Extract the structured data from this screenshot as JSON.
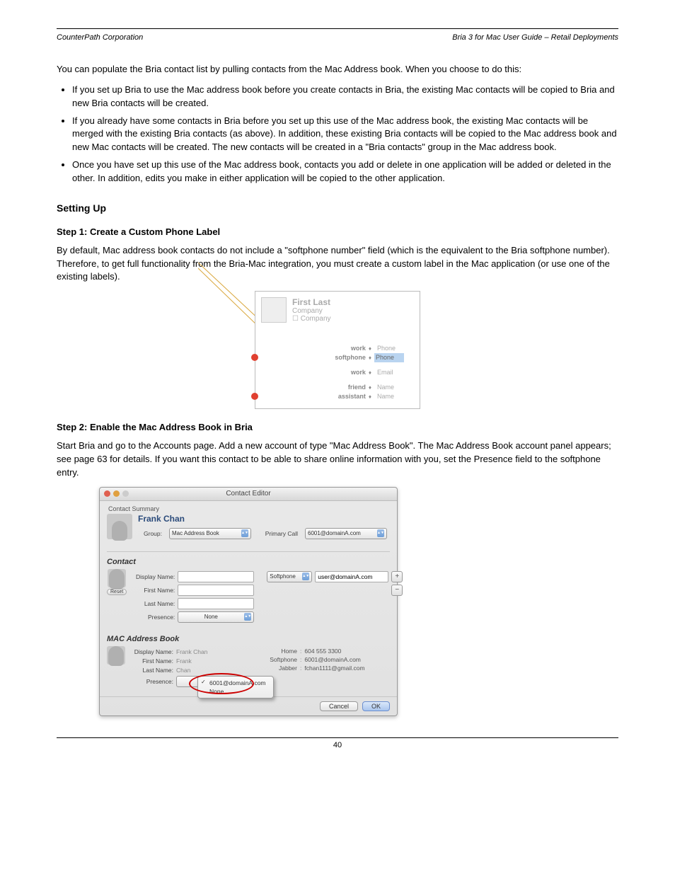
{
  "header": {
    "left": "CounterPath Corporation",
    "right": "Bria 3 for Mac User Guide – Retail Deployments"
  },
  "intro": "You can populate the Bria contact list by pulling contacts from the Mac Address book. When you choose to do this:",
  "bullets": [
    "If you set up Bria to use the Mac address book before you create contacts in Bria, the existing Mac contacts will be copied to Bria and new Bria contacts will be created.",
    "If you already have some contacts in Bria before you set up this use of the Mac address book, the existing Mac contacts will be merged with the existing Bria contacts (as above). In addition, these existing Bria contacts will be copied to the Mac address book and new Mac contacts will be created. The new contacts will be created in a \"Bria contacts\" group in the Mac address book.",
    "Once you have set up this use of the Mac address book, contacts you add or delete in one application will be added or deleted in the other. In addition, edits you make in either application will be copied to the other application."
  ],
  "setupTitle": "Setting Up",
  "step1Title": "Step 1: Create a Custom Phone Label",
  "step1Text": "By default, Mac address book contacts do not include a \"softphone number\" field (which is the equivalent to the Bria softphone number). Therefore, to get full functionality from the Bria-Mac integration, you must create a custom label in the Mac application (or use one of the existing labels).",
  "addressCard": {
    "name": "First Last",
    "company": "Company",
    "companyCheckbox": "Company",
    "fields": [
      {
        "label": "work",
        "value": "Phone"
      },
      {
        "label": "softphone",
        "value": "Phone",
        "removable": true,
        "highlight": true
      },
      {
        "label": "work",
        "value": "Email",
        "groupStart": true
      },
      {
        "label": "friend",
        "value": "Name",
        "groupStart": true
      },
      {
        "label": "assistant",
        "value": "Name",
        "removable": true
      }
    ]
  },
  "step2Title": "Step 2: Enable the Mac Address Book in Bria",
  "step2Text": "Start Bria and go to the Accounts page. Add a new account of type \"Mac Address Book\". The Mac Address Book account panel appears; see page 63 for details. If you want this contact to be able to share online information with you, set the Presence field to the softphone entry.",
  "contactEditor": {
    "title": "Contact Editor",
    "summaryLabel": "Contact Summary",
    "name": "Frank Chan",
    "groupLabel": "Group:",
    "groupValue": "Mac Address Book",
    "primaryCallLabel": "Primary Call",
    "primaryCallValue": "6001@domainA.com",
    "contactSection": "Contact",
    "displayNameLabel": "Display Name:",
    "firstNameLabel": "First Name:",
    "lastNameLabel": "Last Name:",
    "presenceLabel": "Presence:",
    "presenceValue": "None",
    "resetLabel": "Reset",
    "methodType": "Softphone",
    "methodValue": "user@domainA.com",
    "macSection": "MAC Address Book",
    "mac": {
      "displayName": "Frank Chan",
      "firstName": "Frank",
      "lastName": "Chan",
      "entries": [
        {
          "label": "Home",
          "value": "604 555 3300"
        },
        {
          "label": "Softphone",
          "value": "6001@domainA.com"
        },
        {
          "label": "Jabber",
          "value": "fchan1111@gmail.com"
        }
      ]
    },
    "popupOptions": [
      "6001@domainA.com",
      "None"
    ],
    "cancel": "Cancel",
    "ok": "OK"
  },
  "footer": {
    "page": "40"
  }
}
